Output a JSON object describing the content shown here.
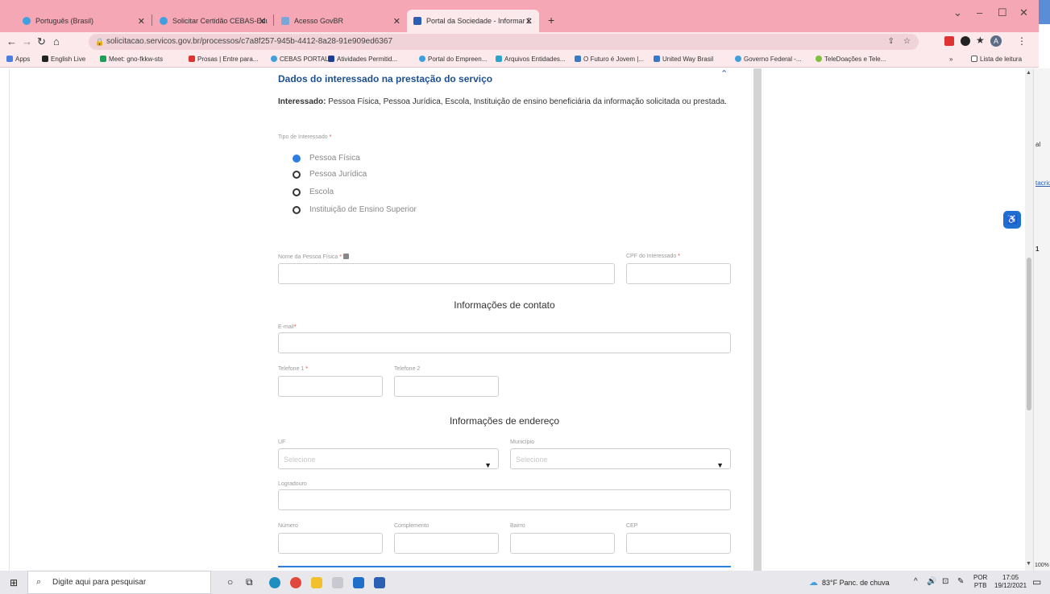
{
  "browser": {
    "tabs": [
      {
        "title": "Português (Brasil)"
      },
      {
        "title": "Solicitar Certidão CEBAS-Educaç"
      },
      {
        "title": "Acesso GovBR"
      },
      {
        "title": "Portal da Sociedade - Informar D"
      }
    ],
    "url": "solicitacao.servicos.gov.br/processos/c7a8f257-945b-4412-8a28-91e909ed6367",
    "bookmarks": [
      "Apps",
      "English Live",
      "Meet: gno-fkkw-sts",
      "Prosas | Entre para...",
      "CEBAS PORTAL",
      "Atividades Permitid...",
      "Portal do Empreen...",
      "Arquivos Entidades...",
      "O Futuro é Jovem |...",
      "United Way Brasil",
      "Governo Federal -...",
      "TeleDoações e Tele..."
    ],
    "reading_list": "Lista de leitura",
    "profile_initial": "A"
  },
  "form": {
    "section_title": "Dados do interessado na prestação do serviço",
    "intro_bold": "Interessado:",
    "intro_text": " Pessoa Física, Pessoa Jurídica, Escola, Instituição de ensino beneficiária da informação solicitada ou prestada.",
    "tipo_label": "Tipo de Interessado",
    "req_mark": "*",
    "tipo_options": [
      {
        "label": "Pessoa Física",
        "selected": true
      },
      {
        "label": "Pessoa Jurídica",
        "selected": false
      },
      {
        "label": "Escola",
        "selected": false
      },
      {
        "label": "Instituição de Ensino Superior",
        "selected": false
      }
    ],
    "nome_label": "Nome da Pessoa Física",
    "cpf_label": "CPF do Interessado",
    "contato_title": "Informações de contato",
    "email_label": "E-mail",
    "tel1_label": "Telefone 1",
    "tel2_label": "Telefone 2",
    "endereco_title": "Informações de endereço",
    "uf_label": "UF",
    "uf_placeholder": "Selecione",
    "municipio_label": "Município",
    "municipio_placeholder": "Selecione",
    "logradouro_label": "Logradouro",
    "numero_label": "Número",
    "complemento_label": "Complemento",
    "bairro_label": "Bairro",
    "cep_label": "CEP"
  },
  "clipped": {
    "a": "al",
    "b": "tacrio",
    "c": "1",
    "zoom": "100%"
  },
  "taskbar": {
    "search_placeholder": "Digite aqui para pesquisar",
    "weather": "83°F Panc. de chuva",
    "lang1": "POR",
    "lang2": "PTB",
    "time": "17:05",
    "date": "19/12/2021"
  }
}
